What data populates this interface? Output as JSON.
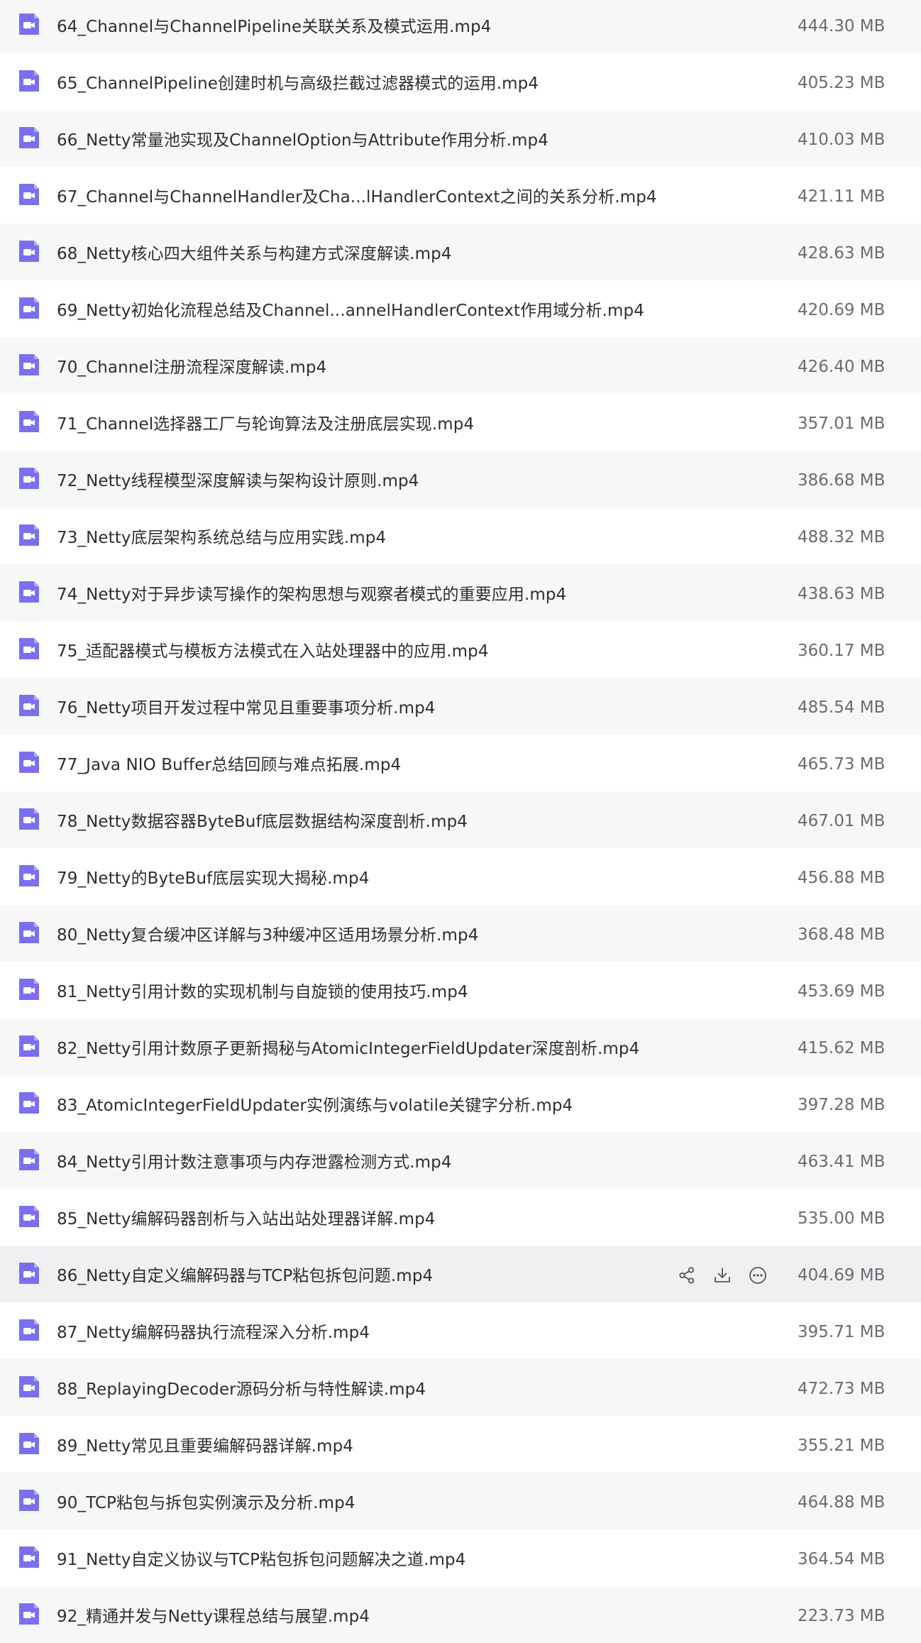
{
  "colors": {
    "row_alt": "#f7f7f8",
    "row_hover": "#f0f0f2",
    "icon_purple": "#7b6ff0",
    "size_text": "#6b6b70"
  },
  "icons": {
    "file": "video-file-icon",
    "share": "share-icon",
    "download": "download-icon",
    "more": "more-icon"
  },
  "hover_index": 22,
  "files": [
    {
      "name": "64_Channel与ChannelPipeline关联关系及模式运用.mp4",
      "size": "444.30 MB"
    },
    {
      "name": "65_ChannelPipeline创建时机与高级拦截过滤器模式的运用.mp4",
      "size": "405.23 MB"
    },
    {
      "name": "66_Netty常量池实现及ChannelOption与Attribute作用分析.mp4",
      "size": "410.03 MB"
    },
    {
      "name": "67_Channel与ChannelHandler及Cha...lHandlerContext之间的关系分析.mp4",
      "size": "421.11 MB"
    },
    {
      "name": "68_Netty核心四大组件关系与构建方式深度解读.mp4",
      "size": "428.63 MB"
    },
    {
      "name": "69_Netty初始化流程总结及Channel...annelHandlerContext作用域分析.mp4",
      "size": "420.69 MB"
    },
    {
      "name": "70_Channel注册流程深度解读.mp4",
      "size": "426.40 MB"
    },
    {
      "name": "71_Channel选择器工厂与轮询算法及注册底层实现.mp4",
      "size": "357.01 MB"
    },
    {
      "name": "72_Netty线程模型深度解读与架构设计原则.mp4",
      "size": "386.68 MB"
    },
    {
      "name": "73_Netty底层架构系统总结与应用实践.mp4",
      "size": "488.32 MB"
    },
    {
      "name": "74_Netty对于异步读写操作的架构思想与观察者模式的重要应用.mp4",
      "size": "438.63 MB"
    },
    {
      "name": "75_适配器模式与模板方法模式在入站处理器中的应用.mp4",
      "size": "360.17 MB"
    },
    {
      "name": "76_Netty项目开发过程中常见且重要事项分析.mp4",
      "size": "485.54 MB"
    },
    {
      "name": "77_Java NIO Buffer总结回顾与难点拓展.mp4",
      "size": "465.73 MB"
    },
    {
      "name": "78_Netty数据容器ByteBuf底层数据结构深度剖析.mp4",
      "size": "467.01 MB"
    },
    {
      "name": "79_Netty的ByteBuf底层实现大揭秘.mp4",
      "size": "456.88 MB"
    },
    {
      "name": "80_Netty复合缓冲区详解与3种缓冲区适用场景分析.mp4",
      "size": "368.48 MB"
    },
    {
      "name": "81_Netty引用计数的实现机制与自旋锁的使用技巧.mp4",
      "size": "453.69 MB"
    },
    {
      "name": "82_Netty引用计数原子更新揭秘与AtomicIntegerFieldUpdater深度剖析.mp4",
      "size": "415.62 MB"
    },
    {
      "name": "83_AtomicIntegerFieldUpdater实例演练与volatile关键字分析.mp4",
      "size": "397.28 MB"
    },
    {
      "name": "84_Netty引用计数注意事项与内存泄露检测方式.mp4",
      "size": "463.41 MB"
    },
    {
      "name": "85_Netty编解码器剖析与入站出站处理器详解.mp4",
      "size": "535.00 MB"
    },
    {
      "name": "86_Netty自定义编解码器与TCP粘包拆包问题.mp4",
      "size": "404.69 MB"
    },
    {
      "name": "87_Netty编解码器执行流程深入分析.mp4",
      "size": "395.71 MB"
    },
    {
      "name": "88_ReplayingDecoder源码分析与特性解读.mp4",
      "size": "472.73 MB"
    },
    {
      "name": "89_Netty常见且重要编解码器详解.mp4",
      "size": "355.21 MB"
    },
    {
      "name": "90_TCP粘包与拆包实例演示及分析.mp4",
      "size": "464.88 MB"
    },
    {
      "name": "91_Netty自定义协议与TCP粘包拆包问题解决之道.mp4",
      "size": "364.54 MB"
    },
    {
      "name": "92_精通并发与Netty课程总结与展望.mp4",
      "size": "223.73 MB"
    }
  ]
}
